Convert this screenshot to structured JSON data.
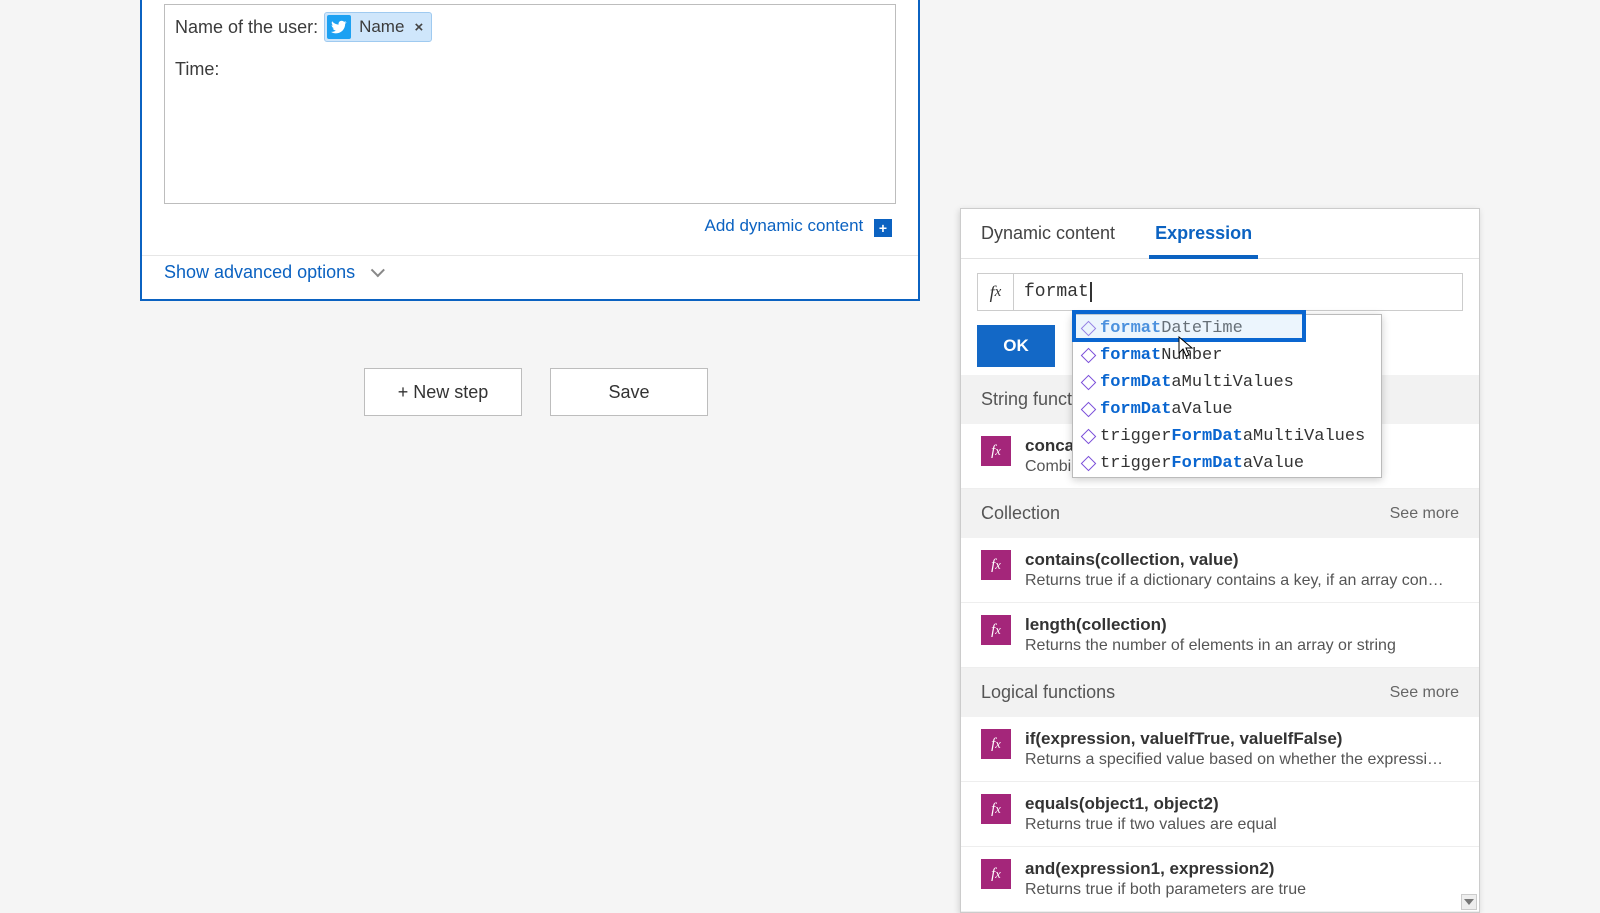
{
  "step": {
    "label_user": "Name of the user:",
    "label_time": "Time:",
    "token_name": "Name",
    "add_dynamic": "Add dynamic content",
    "advanced": "Show advanced options"
  },
  "buttons": {
    "new_step": "+ New step",
    "save": "Save"
  },
  "flyout": {
    "tab_dynamic": "Dynamic content",
    "tab_expression": "Expression",
    "expr_value": "format",
    "ok": "OK",
    "categories": {
      "string": "String functions",
      "collection": "Collection",
      "logical": "Logical functions"
    },
    "see_more": "See more",
    "funcs": {
      "concat_sig": "concat(te",
      "concat_desc": "Combines any number of strings together",
      "contains_sig": "contains(collection, value)",
      "contains_desc": "Returns true if a dictionary contains a key, if an array cont...",
      "length_sig": "length(collection)",
      "length_desc": "Returns the number of elements in an array or string",
      "if_sig": "if(expression, valueIfTrue, valueIfFalse)",
      "if_desc": "Returns a specified value based on whether the expressio...",
      "equals_sig": "equals(object1, object2)",
      "equals_desc": "Returns true if two values are equal",
      "and_sig": "and(expression1, expression2)",
      "and_desc": "Returns true if both parameters are true"
    }
  },
  "autocomplete": {
    "items": [
      {
        "pre": "format",
        "post": "DateTime"
      },
      {
        "pre": "format",
        "post": "Number"
      },
      {
        "pre": "formDat",
        "post": "aMultiValues"
      },
      {
        "pre": "formDat",
        "post": "aValue"
      },
      {
        "pre_plain": "trigger",
        "pre": "FormDat",
        "post": "aMultiValues"
      },
      {
        "pre_plain": "trigger",
        "pre": "FormDat",
        "post": "aValue"
      }
    ]
  }
}
